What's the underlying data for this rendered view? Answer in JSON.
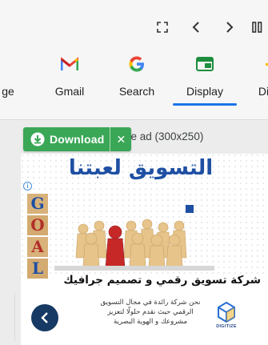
{
  "toolbar": {
    "icons": [
      "fullscreen-icon",
      "chevron-left-icon",
      "chevron-right-icon",
      "pause-icon"
    ]
  },
  "tabs": [
    {
      "label": "ge",
      "icon": "partial-icon"
    },
    {
      "label": "Gmail",
      "icon": "gmail-icon"
    },
    {
      "label": "Search",
      "icon": "google-g-icon"
    },
    {
      "label": "Display",
      "icon": "display-icon",
      "active": true
    },
    {
      "label": "Dis",
      "icon": "partial-icon"
    }
  ],
  "ad": {
    "title": "ge ad (300x250)",
    "download_label": "Download",
    "close_label": "✕",
    "info_label": "i",
    "headline_ar": "التسويق لعبتنا",
    "goal_letters": [
      "G",
      "O",
      "A",
      "L"
    ],
    "company": "شركة تسويق رقمي و تصميم جرافيك",
    "description": "نحن شركة رائدة في مجال التسويق الرقمي حيث نقدم حلولًا لتعزيز مشروعك و الهوية البصرية",
    "logo_text": "DIGITIZE"
  },
  "colors": {
    "accent": "#1a73e8",
    "download_green": "#3aa757",
    "headline_blue": "#1e4fa3",
    "back_button": "#163a63",
    "red_piece": "#c62828"
  }
}
